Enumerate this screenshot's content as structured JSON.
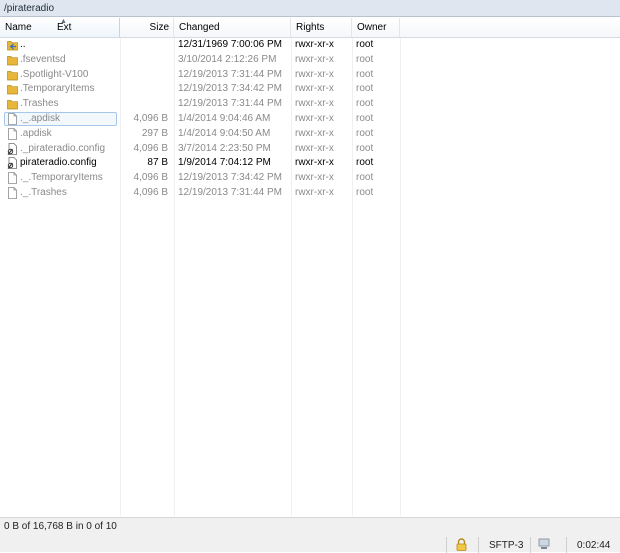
{
  "path": "/pirateradio",
  "columns": {
    "name": "Name",
    "ext": "Ext",
    "size": "Size",
    "changed": "Changed",
    "rights": "Rights",
    "owner": "Owner"
  },
  "files": [
    {
      "name": "..",
      "size": "",
      "changed": "12/31/1969 7:00:06 PM",
      "rights": "rwxr-xr-x",
      "owner": "root",
      "icon": "parent-folder-icon",
      "style": "dark"
    },
    {
      "name": ".fseventsd",
      "size": "",
      "changed": "3/10/2014 2:12:26 PM",
      "rights": "rwxr-xr-x",
      "owner": "root",
      "icon": "folder-icon",
      "style": "dim"
    },
    {
      "name": ".Spotlight-V100",
      "size": "",
      "changed": "12/19/2013 7:31:44 PM",
      "rights": "rwxr-xr-x",
      "owner": "root",
      "icon": "folder-icon",
      "style": "dim"
    },
    {
      "name": ".TemporaryItems",
      "size": "",
      "changed": "12/19/2013 7:34:42 PM",
      "rights": "rwxr-xr-x",
      "owner": "root",
      "icon": "folder-icon",
      "style": "dim"
    },
    {
      "name": ".Trashes",
      "size": "",
      "changed": "12/19/2013 7:31:44 PM",
      "rights": "rwxr-xr-x",
      "owner": "root",
      "icon": "folder-icon",
      "style": "dim"
    },
    {
      "name": "._.apdisk",
      "size": "4,096 B",
      "changed": "1/4/2014 9:04:46 AM",
      "rights": "rwxr-xr-x",
      "owner": "root",
      "icon": "file-icon",
      "style": "dim",
      "selected": true
    },
    {
      "name": ".apdisk",
      "size": "297 B",
      "changed": "1/4/2014 9:04:50 AM",
      "rights": "rwxr-xr-x",
      "owner": "root",
      "icon": "file-icon",
      "style": "dim"
    },
    {
      "name": "._pirateradio.config",
      "size": "4,096 B",
      "changed": "3/7/2014 2:23:50 PM",
      "rights": "rwxr-xr-x",
      "owner": "root",
      "icon": "config-file-icon",
      "style": "dim"
    },
    {
      "name": "pirateradio.config",
      "size": "87 B",
      "changed": "1/9/2014 7:04:12 PM",
      "rights": "rwxr-xr-x",
      "owner": "root",
      "icon": "config-file-icon",
      "style": "dark"
    },
    {
      "name": "._.TemporaryItems",
      "size": "4,096 B",
      "changed": "12/19/2013 7:34:42 PM",
      "rights": "rwxr-xr-x",
      "owner": "root",
      "icon": "file-icon",
      "style": "dim"
    },
    {
      "name": "._.Trashes",
      "size": "4,096 B",
      "changed": "12/19/2013 7:31:44 PM",
      "rights": "rwxr-xr-x",
      "owner": "root",
      "icon": "file-icon",
      "style": "dim"
    }
  ],
  "status": {
    "summary": "0 B of 16,768 B in 0 of 10",
    "protocol": "SFTP-3",
    "elapsed": "0:02:44"
  },
  "colors": {
    "folder": "#e8b73a",
    "path_bar": "#dfe6ef",
    "selection_border": "#a7c7ea"
  }
}
